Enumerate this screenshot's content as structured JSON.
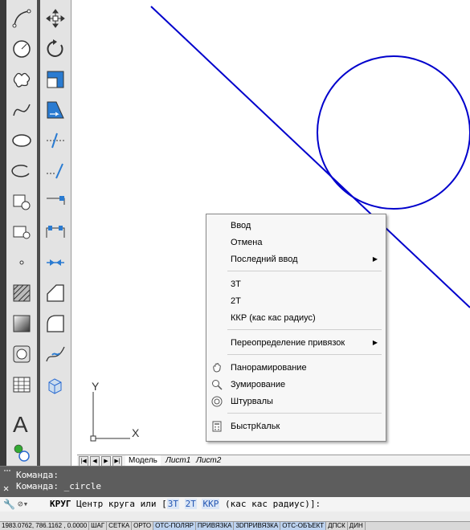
{
  "context_menu": {
    "items": [
      {
        "label": "Ввод"
      },
      {
        "label": "Отмена"
      },
      {
        "label": "Последний ввод"
      },
      {
        "label": "3Т"
      },
      {
        "label": "2Т"
      },
      {
        "label": "ККР (кас кас радиус)"
      },
      {
        "label": "Переопределение привязок"
      },
      {
        "label": "Панорамирование"
      },
      {
        "label": "Зумирование"
      },
      {
        "label": "Штурвалы"
      },
      {
        "label": "БыстрКальк"
      }
    ]
  },
  "ucs": {
    "y_label": "Y",
    "x_label": "X"
  },
  "tabs": {
    "model": "Модель",
    "sheet1": "Лист1",
    "sheet2": "Лист2"
  },
  "command_line": {
    "history": [
      "Команда:",
      "Команда: _circle"
    ],
    "prompt_cmd": "КРУГ",
    "prompt_text": "Центр круга или [",
    "opt1": "3Т",
    "opt2": "2Т",
    "opt3": "ККР",
    "opt3_desc": "(кас кас радиус)",
    "prompt_end": "]:"
  },
  "status_bar": {
    "coords": "1983.0762, 786.1162 , 0.0000",
    "buttons": [
      "ШАГ",
      "СЕТКА",
      "ОРТО",
      "ОТС-ПОЛЯР",
      "ПРИВЯЗКА",
      "3DПРИВЯЗКА",
      "ОТС-ОБЪЕКТ",
      "ДПСК",
      "ДИН"
    ]
  },
  "colors": {
    "drawing_line": "#0000cc",
    "status_on": "#bcd2ef"
  }
}
